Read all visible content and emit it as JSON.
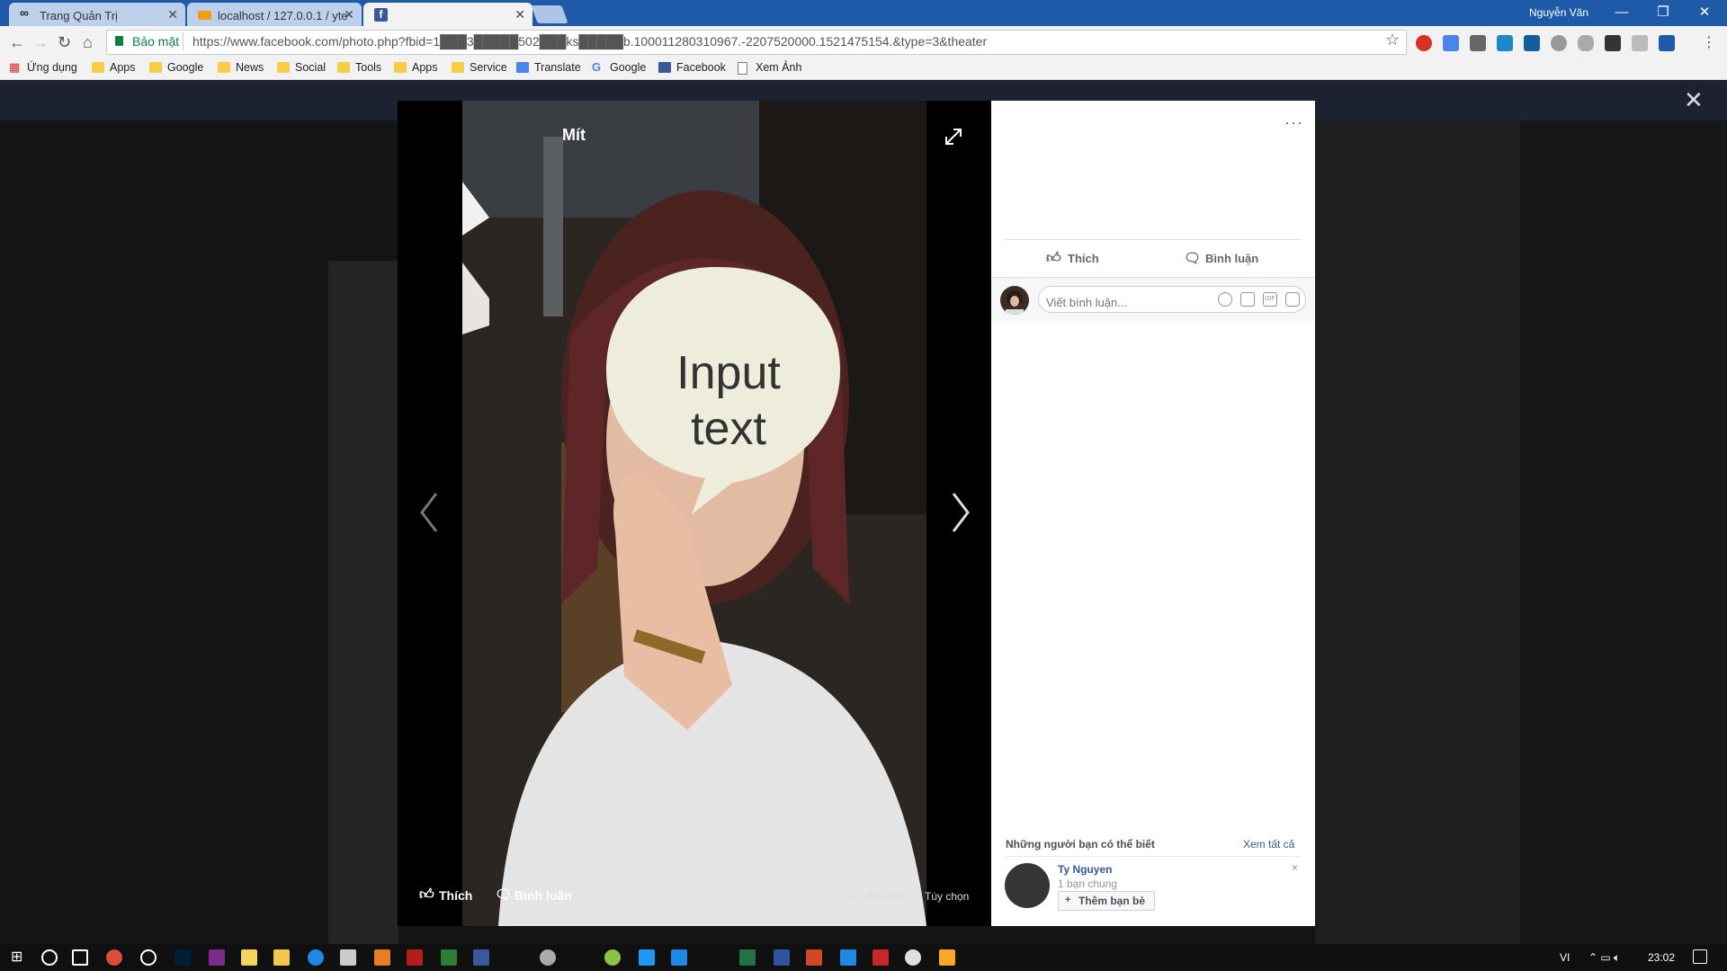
{
  "browser": {
    "tabs": [
      {
        "title": "Trang Quản Trị",
        "icon": "mustache-icon"
      },
      {
        "title": "localhost / 127.0.0.1 / yte",
        "icon": "phpmyadmin-icon"
      },
      {
        "title": "",
        "icon": "facebook-icon"
      }
    ],
    "user": "Nguyễn Văn",
    "secure_label": "Bảo mật",
    "url": "https://www.facebook.com/photo.php?fbid=1███3█████502███ks█████b.100011280310967.-2207520000.1521475154.&type=3&theater",
    "bookmarks": [
      {
        "label": "Ứng dụng",
        "icon": "apps-grid-icon"
      },
      {
        "label": "Apps",
        "icon": "folder-icon"
      },
      {
        "label": "Google",
        "icon": "folder-icon"
      },
      {
        "label": "News",
        "icon": "folder-icon"
      },
      {
        "label": "Social",
        "icon": "folder-icon"
      },
      {
        "label": "Tools",
        "icon": "folder-icon"
      },
      {
        "label": "Apps",
        "icon": "folder-icon"
      },
      {
        "label": "Service",
        "icon": "folder-icon"
      },
      {
        "label": "Translate",
        "icon": "translate-icon"
      },
      {
        "label": "Google",
        "icon": "google-icon"
      },
      {
        "label": "Facebook",
        "icon": "facebook-icon"
      },
      {
        "label": "Xem Ảnh",
        "icon": "page-icon"
      }
    ]
  },
  "theater": {
    "name_tag": "Mít",
    "speech_bubble": "Input text",
    "like": "Thích",
    "comment": "Bình luận",
    "tag_photo": "Gắn thẻ ảnh",
    "options": "Tùy chọn"
  },
  "panel": {
    "more": "···",
    "like": "Thích",
    "comment": "Bình luận",
    "comment_placeholder": "Viết bình luận...",
    "pymk_title": "Những người bạn có thể biết",
    "pymk_see_all": "Xem tất cả",
    "friend": {
      "name": "Ty Nguyen",
      "mutual": "1 bạn chung",
      "add_label": "Thêm bạn bè",
      "dismiss": "×"
    }
  },
  "taskbar": {
    "language": "VI",
    "time": "23:02"
  }
}
